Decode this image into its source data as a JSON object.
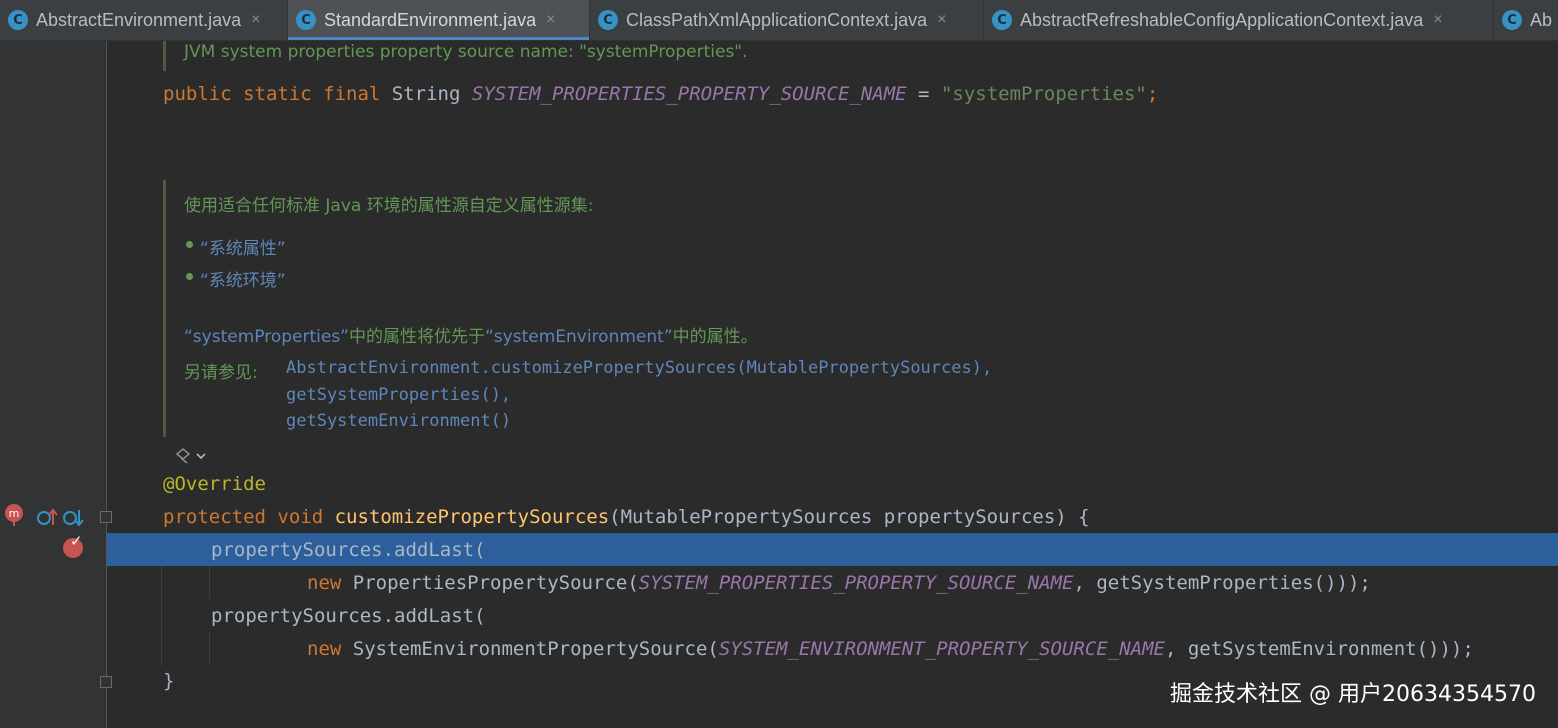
{
  "tabs": [
    {
      "label": "AbstractEnvironment.java",
      "icon": "class-icon"
    },
    {
      "label": "StandardEnvironment.java",
      "icon": "class-icon"
    },
    {
      "label": "ClassPathXmlApplicationContext.java",
      "icon": "class-icon"
    },
    {
      "label": "AbstractRefreshableConfigApplicationContext.java",
      "icon": "class-icon"
    },
    {
      "label": "Ab",
      "icon": "class-icon"
    }
  ],
  "tab_close_glyph": "×",
  "tab_icon_letter": "C",
  "doc1": {
    "text": "JVM system properties property source name: \"systemProperties\"."
  },
  "line1": {
    "kw": "public static final",
    "type": "String",
    "const": "SYSTEM_PROPERTIES_PROPERTY_SOURCE_NAME",
    "eq": "=",
    "str": "\"systemProperties\"",
    "semi": ";"
  },
  "doc2": {
    "summary": "使用适合任何标准 Java 环境的属性源自定义属性源集:",
    "bullets": [
      "“系统属性”",
      "“系统环境”"
    ],
    "priority_a": "“systemProperties”",
    "priority_b": "中的属性将优先于",
    "priority_c": "“systemEnvironment”",
    "priority_d": "中的属性。",
    "see_also_label": "另请参见:",
    "see_also": [
      "AbstractEnvironment.customizePropertySources(MutablePropertySources),",
      "getSystemProperties(),",
      "getSystemEnvironment()"
    ]
  },
  "code": {
    "annotation": "@Override",
    "sig_kw": "protected void",
    "sig_fn": "customizePropertySources",
    "sig_rest": "(MutablePropertySources propertySources) {",
    "l1": "propertySources.addLast(",
    "l2_kw": "new",
    "l2_a": "PropertiesPropertySource(",
    "l2_const": "SYSTEM_PROPERTIES_PROPERTY_SOURCE_NAME",
    "l2_b": ", getSystemProperties()));",
    "l3": "propertySources.addLast(",
    "l4_kw": "new",
    "l4_a": "SystemEnvironmentPropertySource(",
    "l4_const": "SYSTEM_ENVIRONMENT_PROPERTY_SOURCE_NAME",
    "l4_b": ", getSystemEnvironment()));",
    "close": "}"
  },
  "watermark": "掘金技术社区 @ 用户20634354570",
  "colors": {
    "keyword": "#cc7832",
    "constant": "#9876aa",
    "string": "#6a8759",
    "annotation": "#bbb529",
    "function": "#ffc66d",
    "doc": "#629755",
    "highlight": "#2d5f9c"
  }
}
